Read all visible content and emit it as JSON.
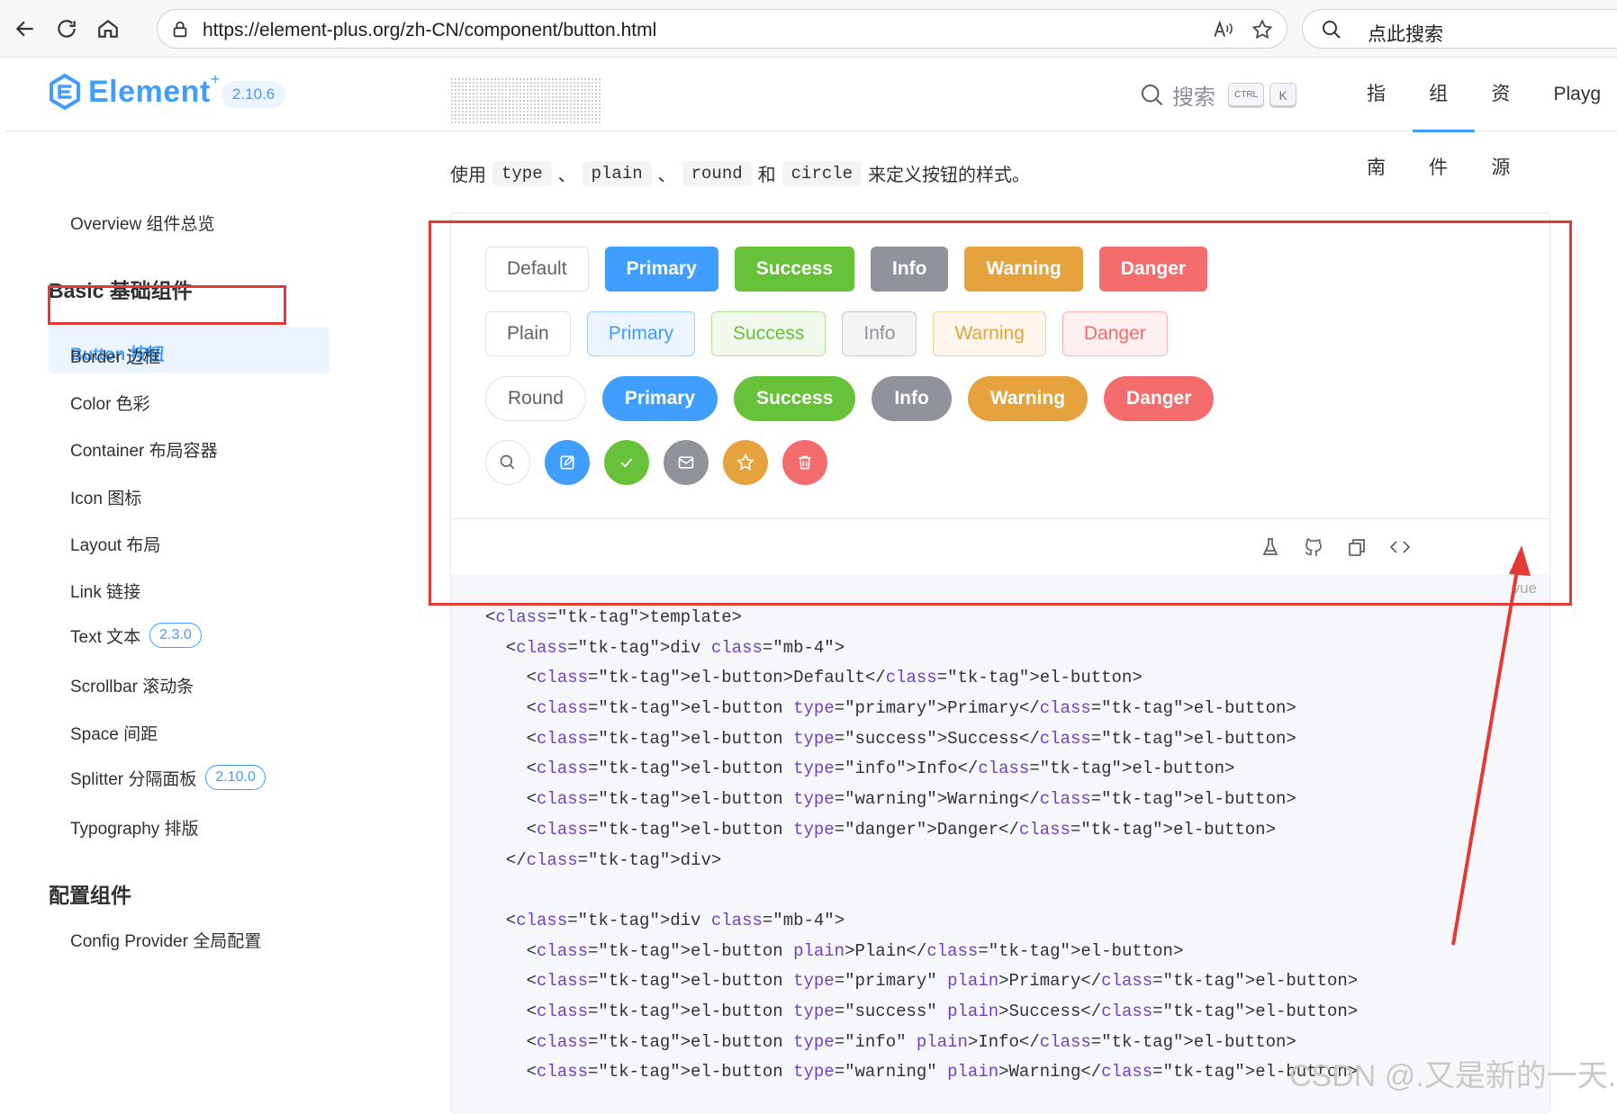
{
  "browser": {
    "url": "https://element-plus.org/zh-CN/component/button.html",
    "search_placeholder": "点此搜索"
  },
  "header": {
    "logo_text": "Element",
    "logo_sup": "+",
    "version": "2.10.6",
    "search_label": "搜索",
    "kbd_ctrl": "CTRL",
    "kbd_k": "K",
    "nav": [
      "指南",
      "组件",
      "资源",
      "Playg"
    ],
    "active_nav": "组件"
  },
  "sidebar": {
    "overview": "Overview 组件总览",
    "group_basic": "Basic 基础组件",
    "active_item": "Button 按钮",
    "items": [
      {
        "label": "Border 边框",
        "badge": ""
      },
      {
        "label": "Color 色彩",
        "badge": ""
      },
      {
        "label": "Container 布局容器",
        "badge": ""
      },
      {
        "label": "Icon 图标",
        "badge": ""
      },
      {
        "label": "Layout 布局",
        "badge": ""
      },
      {
        "label": "Link 链接",
        "badge": ""
      },
      {
        "label": "Text 文本",
        "badge": "2.3.0"
      },
      {
        "label": "Scrollbar 滚动条",
        "badge": ""
      },
      {
        "label": "Space 间距",
        "badge": ""
      },
      {
        "label": "Splitter 分隔面板",
        "badge": "2.10.0"
      },
      {
        "label": "Typography 排版",
        "badge": ""
      }
    ],
    "group_config": "配置组件",
    "config_item": "Config Provider 全局配置"
  },
  "main": {
    "intro_prefix": "使用",
    "intro_codes": [
      "type",
      "plain",
      "round",
      "circle"
    ],
    "intro_sep": "、",
    "intro_and": "和",
    "intro_suffix": "来定义按钮的样式。",
    "rows": {
      "default": [
        "Default",
        "Primary",
        "Success",
        "Info",
        "Warning",
        "Danger"
      ],
      "plain": [
        "Plain",
        "Primary",
        "Success",
        "Info",
        "Warning",
        "Danger"
      ],
      "round": [
        "Round",
        "Primary",
        "Success",
        "Info",
        "Warning",
        "Danger"
      ]
    },
    "circle_icons": [
      "search-icon",
      "edit-icon",
      "check-icon",
      "message-icon",
      "star-icon",
      "delete-icon"
    ],
    "toolbar_icons": [
      "playground-icon",
      "github-icon",
      "copy-icon",
      "view-source-icon"
    ],
    "code_lang": "vue",
    "code_lines": [
      "<template>",
      "  <div class=\"mb-4\">",
      "    <el-button>Default</el-button>",
      "    <el-button type=\"primary\">Primary</el-button>",
      "    <el-button type=\"success\">Success</el-button>",
      "    <el-button type=\"info\">Info</el-button>",
      "    <el-button type=\"warning\">Warning</el-button>",
      "    <el-button type=\"danger\">Danger</el-button>",
      "  </div>",
      "",
      "  <div class=\"mb-4\">",
      "    <el-button plain>Plain</el-button>",
      "    <el-button type=\"primary\" plain>Primary</el-button>",
      "    <el-button type=\"success\" plain>Success</el-button>",
      "    <el-button type=\"info\" plain>Info</el-button>",
      "    <el-button type=\"warning\" plain>Warning</el-button>"
    ]
  },
  "watermark": "CSDN @.又是新的一天.",
  "colors": {
    "primary": "#409eff",
    "success": "#67c23a",
    "info": "#909399",
    "warning": "#e6a23c",
    "danger": "#f56c6c",
    "highlight": "#e53935"
  }
}
